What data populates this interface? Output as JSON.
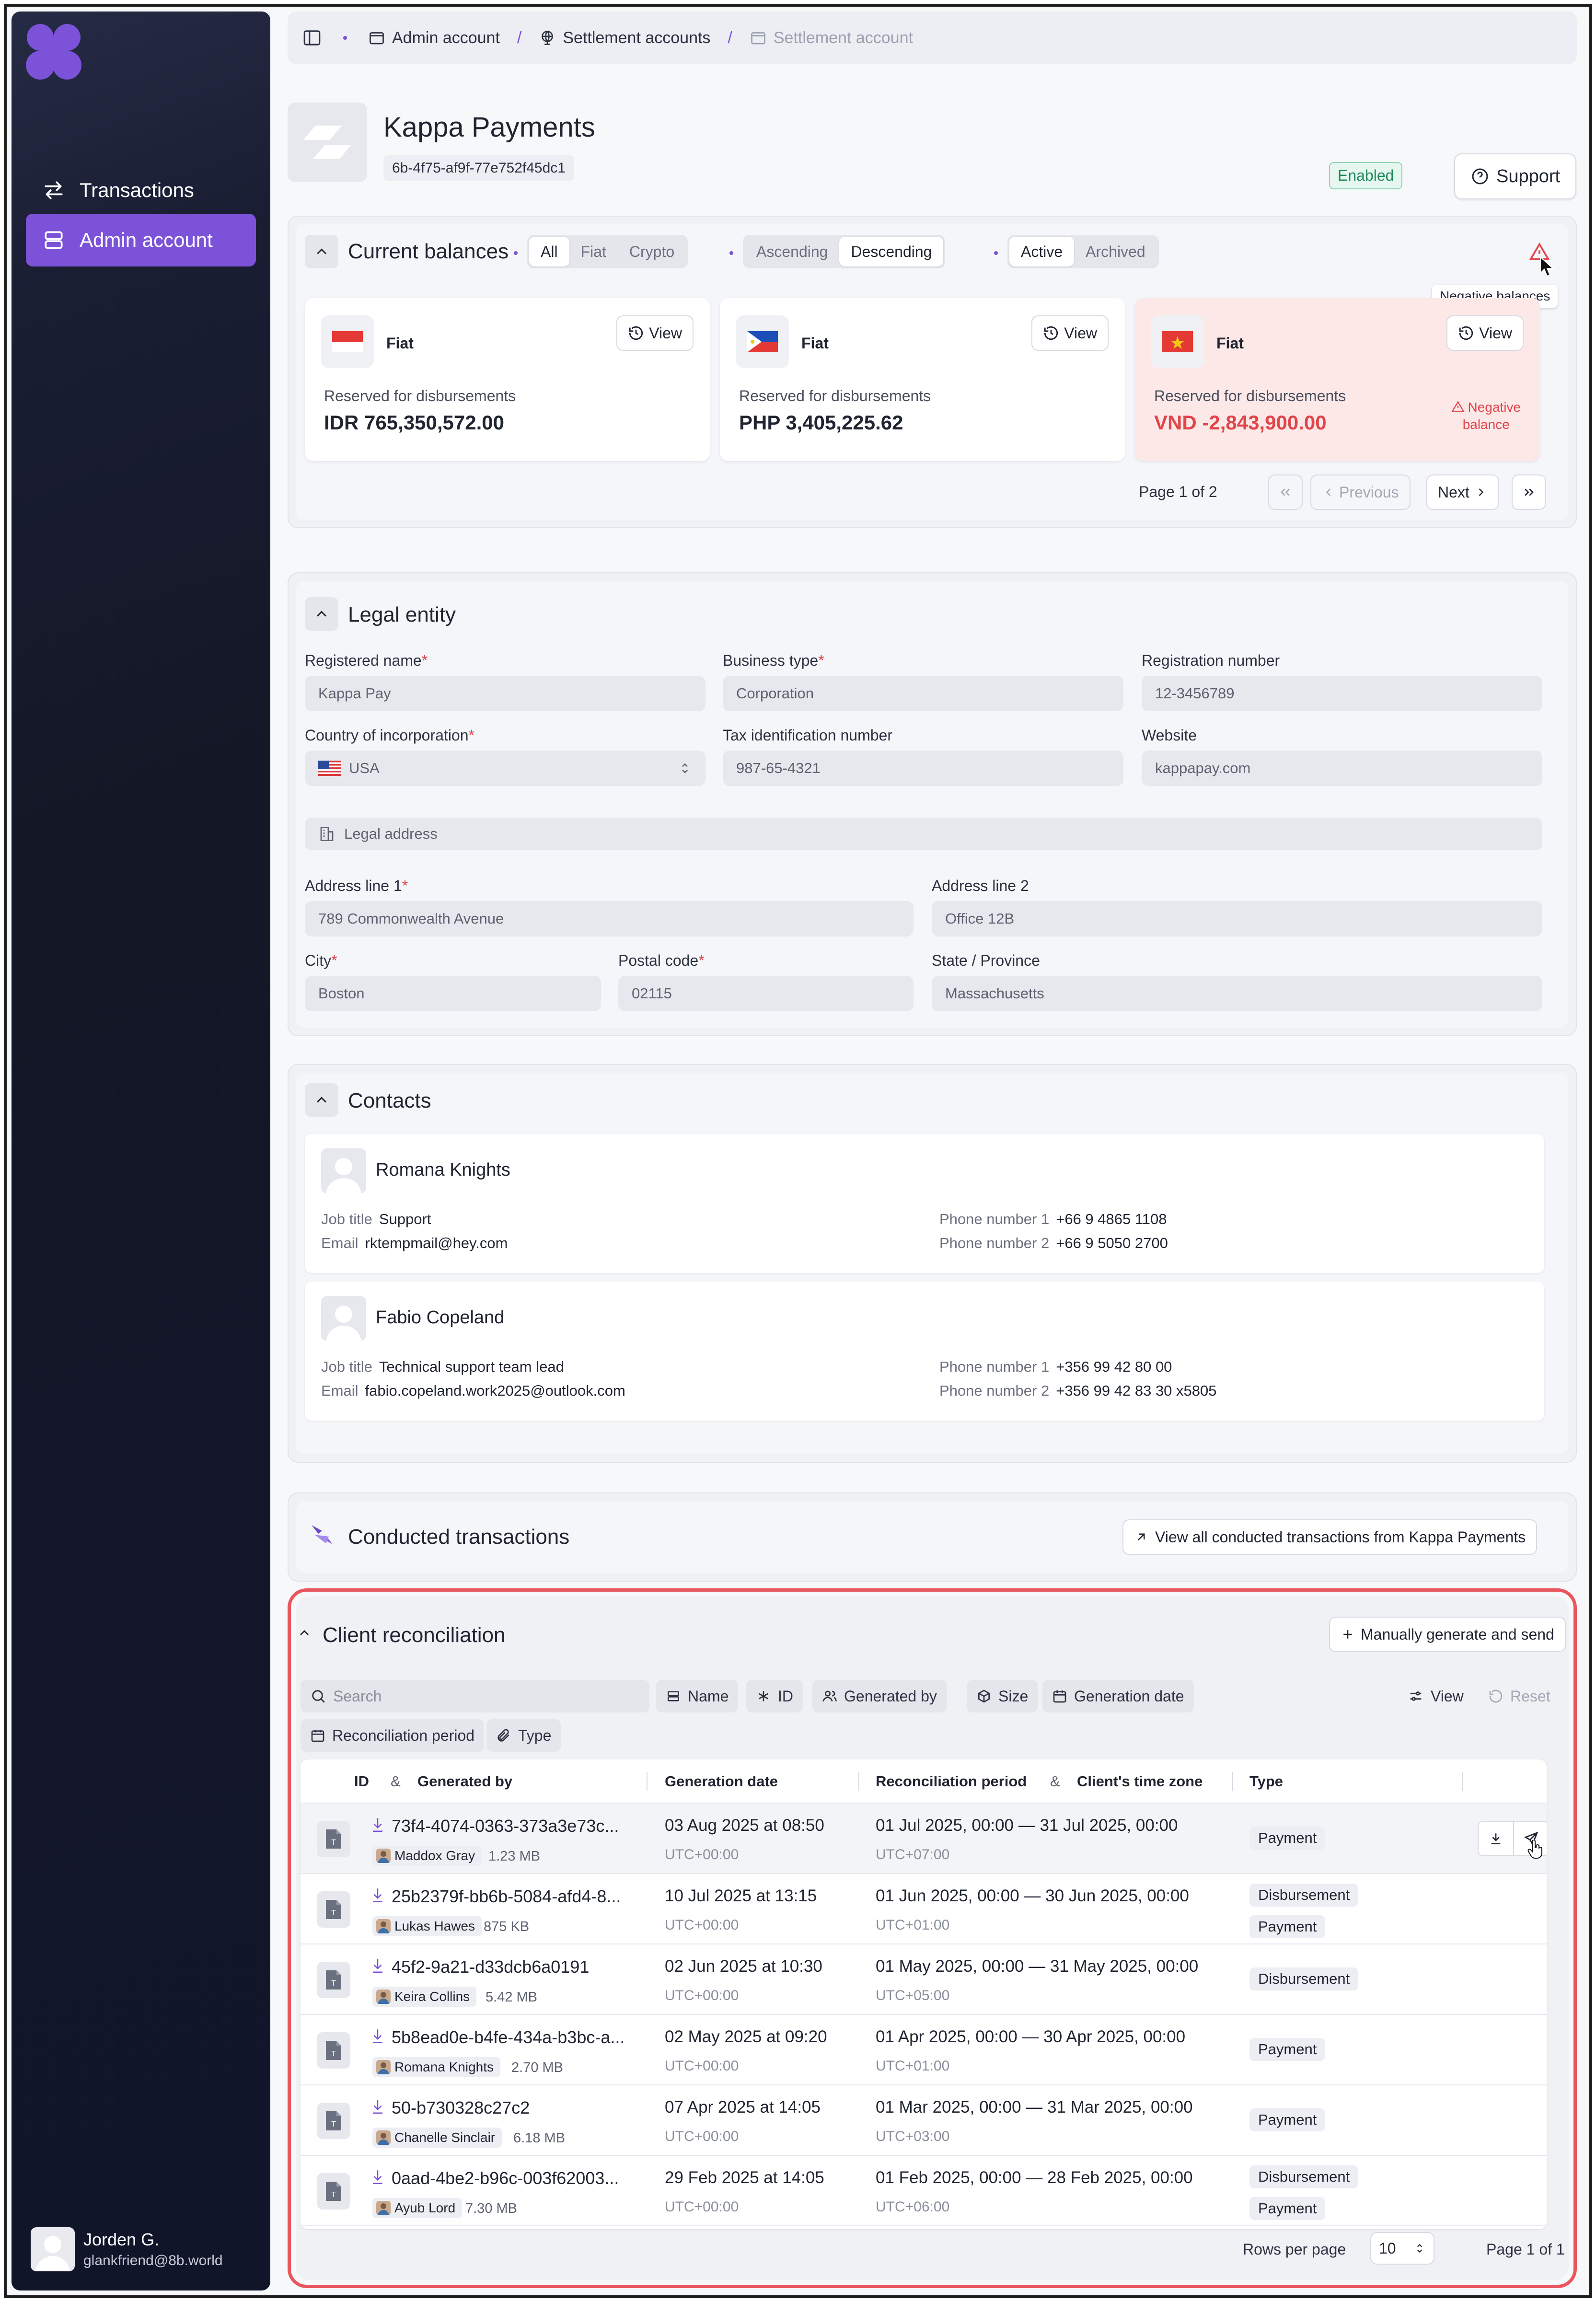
{
  "sidebar": {
    "nav": [
      {
        "label": "Transactions",
        "icon": "arrows-exchange-icon"
      },
      {
        "label": "Admin account",
        "icon": "server-icon"
      }
    ],
    "user": {
      "name": "Jorden G.",
      "email": "glankfriend@8b.world"
    }
  },
  "breadcrumbs": [
    "Admin account",
    "Settlement accounts",
    "Settlement account"
  ],
  "header": {
    "title": "Kappa Payments",
    "id": "6b-4f75-af9f-77e752f45dc1",
    "status": "Enabled",
    "support_label": "Support"
  },
  "balances": {
    "title": "Current balances",
    "filters": [
      "All",
      "Fiat",
      "Crypto"
    ],
    "sort": [
      "Ascending",
      "Descending"
    ],
    "state": [
      "Active",
      "Archived"
    ],
    "tooltip": "Negative balances",
    "cards": [
      {
        "kind": "Fiat",
        "view": "View",
        "reserved": "Reserved for disbursements",
        "amount": "IDR 765,350,572.00",
        "flag": "indonesia"
      },
      {
        "kind": "Fiat",
        "view": "View",
        "reserved": "Reserved for disbursements",
        "amount": "PHP 3,405,225.62",
        "flag": "philippines"
      },
      {
        "kind": "Fiat",
        "view": "View",
        "reserved": "Reserved for disbursements",
        "amount": "VND -2,843,900.00",
        "flag": "vietnam",
        "negative_line1": "Negative",
        "negative_line2": "balance"
      }
    ],
    "page": "Page 1 of 2",
    "prev": "Previous",
    "next": "Next"
  },
  "legal": {
    "title": "Legal entity",
    "registered_name": {
      "label": "Registered name",
      "value": "Kappa Pay"
    },
    "business_type": {
      "label": "Business type",
      "value": "Corporation"
    },
    "registration_number": {
      "label": "Registration number",
      "value": "12-3456789"
    },
    "country": {
      "label": "Country of incorporation",
      "value": "USA"
    },
    "tax_id": {
      "label": "Tax identification number",
      "value": "987-65-4321"
    },
    "website": {
      "label": "Website",
      "value": "kappapay.com"
    },
    "legal_address": "Legal address",
    "address1": {
      "label": "Address line 1",
      "value": "789 Commonwealth Avenue"
    },
    "address2": {
      "label": "Address line 2",
      "value": "Office 12B"
    },
    "city": {
      "label": "City",
      "value": "Boston"
    },
    "postal": {
      "label": "Postal code",
      "value": "02115"
    },
    "state": {
      "label": "State / Province",
      "value": "Massachusetts"
    }
  },
  "contacts": {
    "title": "Contacts",
    "job_label": "Job title",
    "email_label": "Email",
    "phone1_label": "Phone number 1",
    "phone2_label": "Phone number 2",
    "items": [
      {
        "name": "Romana Knights",
        "job": "Support",
        "email": "rktempmail@hey.com",
        "phone1": "+66 9 4865 1108",
        "phone2": "+66 9 5050 2700"
      },
      {
        "name": "Fabio Copeland",
        "job": "Technical support team lead",
        "email": "fabio.copeland.work2025@outlook.com",
        "phone1": "+356 99 42 80 00",
        "phone2": "+356 99 42 83 30 x5805"
      }
    ]
  },
  "conducted": {
    "title": "Conducted transactions",
    "link": "View all conducted transactions from Kappa Payments"
  },
  "reconciliation": {
    "title": "Client reconciliation",
    "generate": "Manually generate and send",
    "search_placeholder": "Search",
    "chips": [
      "Name",
      "ID",
      "Generated by",
      "Size",
      "Generation date",
      "Reconciliation period",
      "Type"
    ],
    "view": "View",
    "reset": "Reset",
    "columns": {
      "id": "ID",
      "amp1": "&",
      "generated_by": "Generated by",
      "generation_date": "Generation date",
      "period": "Reconciliation period",
      "amp2": "&",
      "tz": "Client's time zone",
      "type": "Type"
    },
    "rows": [
      {
        "id": "73f4-4074-0363-373a3e73c...",
        "by": "Maddox Gray",
        "size": "1.23 MB",
        "date": "03 Aug 2025 at 08:50",
        "date_tz": "UTC+00:00",
        "period": "01 Jul 2025, 00:00 — 31 Jul 2025, 00:00",
        "period_tz": "UTC+07:00",
        "types": [
          "Payment"
        ]
      },
      {
        "id": "25b2379f-bb6b-5084-afd4-8...",
        "by": "Lukas Hawes",
        "size": "875 KB",
        "date": "10 Jul 2025 at 13:15",
        "date_tz": "UTC+00:00",
        "period": "01 Jun 2025, 00:00 — 30 Jun 2025, 00:00",
        "period_tz": "UTC+01:00",
        "types": [
          "Disbursement",
          "Payment"
        ]
      },
      {
        "id": "45f2-9a21-d33dcb6a0191",
        "by": "Keira Collins",
        "size": "5.42 MB",
        "date": "02 Jun 2025 at 10:30",
        "date_tz": "UTC+00:00",
        "period": "01 May 2025, 00:00 — 31 May 2025, 00:00",
        "period_tz": "UTC+05:00",
        "types": [
          "Disbursement"
        ]
      },
      {
        "id": "5b8ead0e-b4fe-434a-b3bc-a...",
        "by": "Romana Knights",
        "size": "2.70 MB",
        "date": "02 May 2025 at 09:20",
        "date_tz": "UTC+00:00",
        "period": "01 Apr 2025, 00:00 — 30 Apr 2025, 00:00",
        "period_tz": "UTC+01:00",
        "types": [
          "Payment"
        ]
      },
      {
        "id": "50-b730328c27c2",
        "by": "Chanelle Sinclair",
        "size": "6.18 MB",
        "date": "07 Apr 2025 at 14:05",
        "date_tz": "UTC+00:00",
        "period": "01 Mar 2025, 00:00 — 31 Mar 2025, 00:00",
        "period_tz": "UTC+03:00",
        "types": [
          "Payment"
        ]
      },
      {
        "id": "0aad-4be2-b96c-003f62003...",
        "by": "Ayub Lord",
        "size": "7.30 MB",
        "date": "29 Feb 2025 at 14:05",
        "date_tz": "UTC+00:00",
        "period": "01 Feb 2025, 00:00 — 28 Feb 2025, 00:00",
        "period_tz": "UTC+06:00",
        "types": [
          "Disbursement",
          "Payment"
        ]
      }
    ],
    "rows_per_page_label": "Rows per page",
    "rows_per_page": "10",
    "page": "Page 1 of 1"
  },
  "colors": {
    "accent": "#7b52d8",
    "danger": "#e0454a",
    "success": "#1f8a5b"
  }
}
